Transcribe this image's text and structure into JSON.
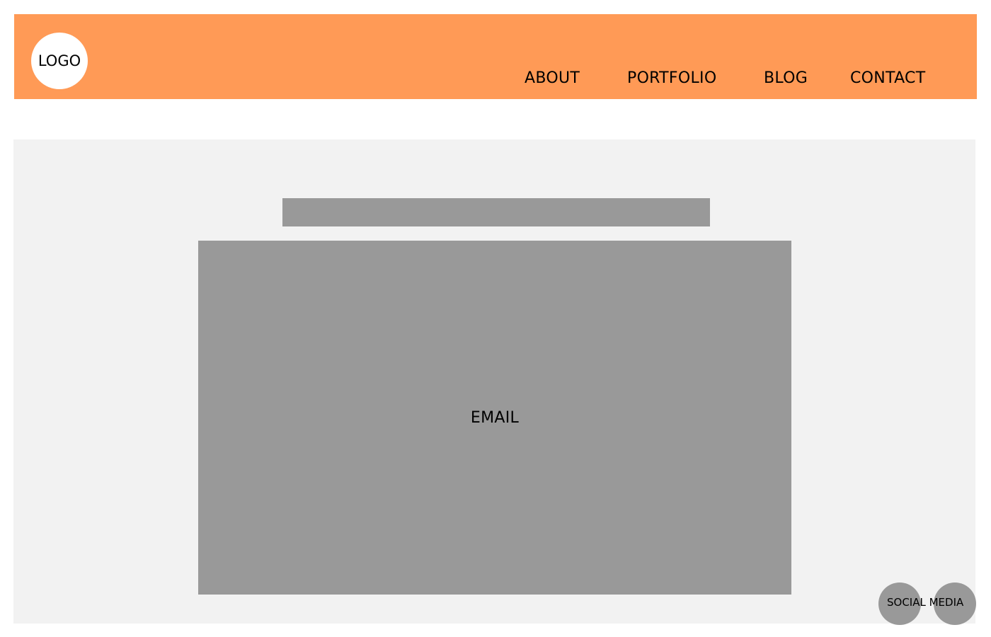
{
  "header": {
    "logo_label": "LOGO",
    "nav": {
      "about": "ABOUT",
      "portfolio": "PORTFOLIO",
      "blog": "BLOG",
      "contact": "CONTACT"
    }
  },
  "main": {
    "email_label": "EMAIL"
  },
  "footer": {
    "social_label": "SOCIAL MEDIA"
  },
  "colors": {
    "header_bg": "#ff9a56",
    "content_bg": "#f2f2f2",
    "placeholder_gray": "#999999"
  }
}
